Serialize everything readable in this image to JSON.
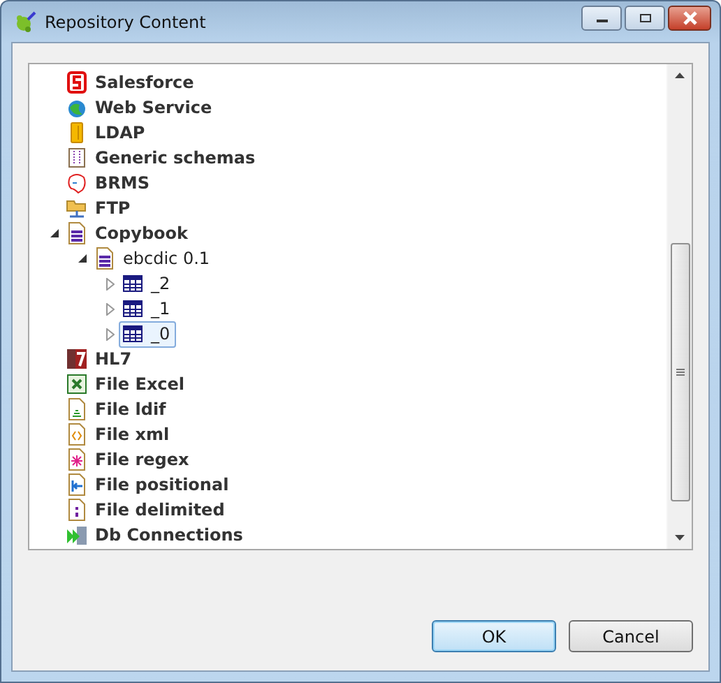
{
  "window": {
    "title": "Repository Content"
  },
  "tree": [
    {
      "label": "Salesforce",
      "kind": "salesforce",
      "selected": false
    },
    {
      "label": "Web Service",
      "kind": "webservice",
      "selected": false
    },
    {
      "label": "LDAP",
      "kind": "ldap",
      "selected": false
    },
    {
      "label": "Generic schemas",
      "kind": "schema",
      "selected": false
    },
    {
      "label": "BRMS",
      "kind": "brms",
      "selected": false
    },
    {
      "label": "FTP",
      "kind": "ftp",
      "selected": false
    },
    {
      "label": "Copybook",
      "kind": "copybook",
      "selected": false,
      "expanded": true,
      "children": [
        {
          "label": "ebcdic 0.1",
          "kind": "copybook",
          "selected": false,
          "expanded": true,
          "children": [
            {
              "label": "_2",
              "kind": "table",
              "selected": false,
              "expanded": false
            },
            {
              "label": "_1",
              "kind": "table",
              "selected": false,
              "expanded": false
            },
            {
              "label": "_0",
              "kind": "table",
              "selected": true,
              "expanded": false
            }
          ]
        }
      ]
    },
    {
      "label": "HL7",
      "kind": "hl7",
      "selected": false
    },
    {
      "label": "File Excel",
      "kind": "excel",
      "selected": false
    },
    {
      "label": "File ldif",
      "kind": "ldif",
      "selected": false
    },
    {
      "label": "File xml",
      "kind": "xml",
      "selected": false
    },
    {
      "label": "File regex",
      "kind": "regex",
      "selected": false
    },
    {
      "label": "File positional",
      "kind": "positional",
      "selected": false
    },
    {
      "label": "File delimited",
      "kind": "delimited",
      "selected": false
    },
    {
      "label": "Db Connections",
      "kind": "db",
      "selected": false
    }
  ],
  "buttons": [
    {
      "label": "OK",
      "default": true
    },
    {
      "label": "Cancel",
      "default": false
    }
  ]
}
